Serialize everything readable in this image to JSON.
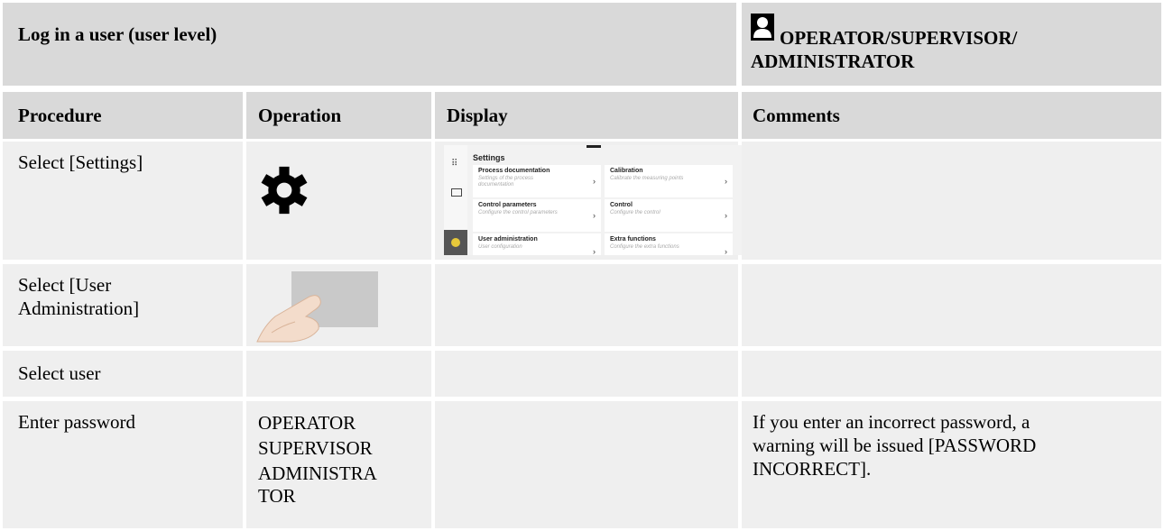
{
  "title": "Log in a user (user level)",
  "role": {
    "icon": "user-icon",
    "line1": "OPERATOR/SUPERVISOR/",
    "line2": "ADMINISTRATOR"
  },
  "headers": {
    "procedure": "Procedure",
    "operation": "Operation",
    "display": "Display",
    "comments": "Comments"
  },
  "rows": [
    {
      "procedure": "Select [Settings]",
      "operation_icon": "gear-icon",
      "comment": ""
    },
    {
      "procedure_line1": "Select [User",
      "procedure_line2": "Administration]",
      "operation_icon": "finger-tap-icon",
      "comment": ""
    },
    {
      "procedure": "Select user",
      "comment": ""
    },
    {
      "procedure": "Enter password",
      "operation_lines": [
        "OPERATOR",
        "SUPERVISOR",
        "ADMINISTRA",
        "TOR"
      ],
      "comment_lines": [
        "If you enter an incorrect password, a",
        "warning will be issued [PASSWORD",
        "INCORRECT]."
      ]
    }
  ],
  "display_screen": {
    "title": "Settings",
    "cards": [
      {
        "title": "Process documentation",
        "subtitle_line1": "Settings of the process",
        "subtitle_line2": "documentation"
      },
      {
        "title": "Calibration",
        "subtitle_line1": "Calibrate the measuring points",
        "subtitle_line2": ""
      },
      {
        "title": "Control parameters",
        "subtitle_line1": "Configure the control parameters",
        "subtitle_line2": ""
      },
      {
        "title": "Control",
        "subtitle_line1": "Configure the control",
        "subtitle_line2": ""
      },
      {
        "title": "User administration",
        "subtitle_line1": "User configuration",
        "subtitle_line2": ""
      },
      {
        "title": "Extra functions",
        "subtitle_line1": "Configure the extra functions",
        "subtitle_line2": ""
      }
    ],
    "accent_color": "#e6c83a"
  }
}
